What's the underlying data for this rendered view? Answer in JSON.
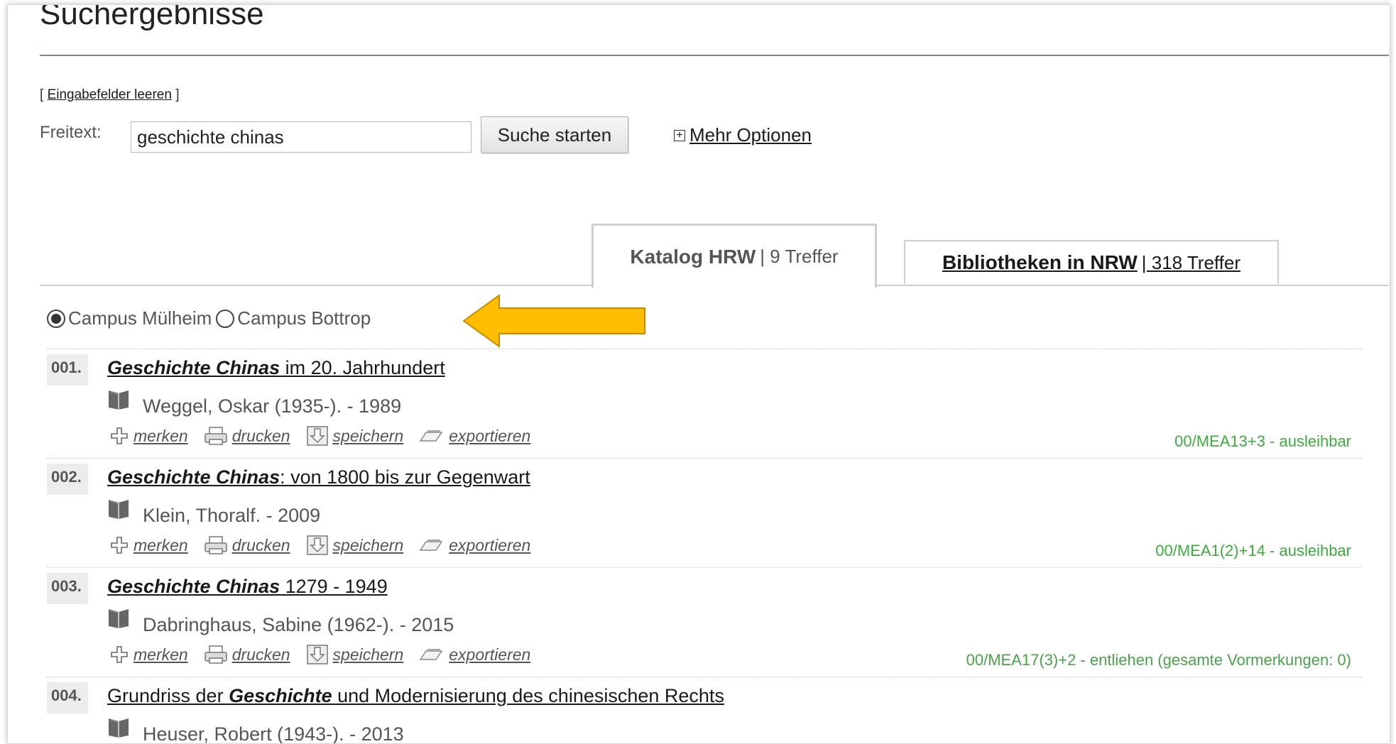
{
  "page_title": "Suchergebnisse",
  "search": {
    "clear_open": "[",
    "clear_label": "Eingabefelder leeren",
    "clear_close": "]",
    "freitext_label": "Freitext:",
    "query_value": "geschichte chinas",
    "submit_label": "Suche starten",
    "more_options_label": "Mehr Optionen"
  },
  "tabs": [
    {
      "name": "Katalog HRW",
      "count": "| 9 Treffer",
      "active": true
    },
    {
      "name": "Bibliotheken in NRW",
      "count": "| 318 Treffer",
      "active": false
    }
  ],
  "campus": [
    {
      "label": "Campus Mülheim",
      "selected": true
    },
    {
      "label": "Campus Bottrop",
      "selected": false
    }
  ],
  "arrow_color": "#ffbf00",
  "actions": {
    "merken": "merken",
    "drucken": "drucken",
    "speichern": "speichern",
    "exportieren": "exportieren"
  },
  "results": [
    {
      "number": "001.",
      "title_bold": "Geschichte Chinas",
      "title_rest": " im 20. Jahrhundert",
      "author": "Weggel, Oskar (1935-). - 1989",
      "status": "00/MEA13+3 - ausleihbar"
    },
    {
      "number": "002.",
      "title_bold": "Geschichte Chinas",
      "title_rest": ": von 1800 bis zur Gegenwart",
      "author": "Klein, Thoralf. - 2009",
      "status": "00/MEA1(2)+14 - ausleihbar"
    },
    {
      "number": "003.",
      "title_bold": "Geschichte Chinas",
      "title_rest": " 1279 - 1949",
      "author": "Dabringhaus, Sabine (1962-). - 2015",
      "status": "00/MEA17(3)+2 - entliehen (gesamte Vormerkungen: 0)"
    },
    {
      "number": "004.",
      "title_pre": "Grundriss der ",
      "title_bold": "Geschichte",
      "title_rest": " und Modernisierung des chinesischen Rechts",
      "author": "Heuser, Robert (1943-). - 2013"
    }
  ]
}
